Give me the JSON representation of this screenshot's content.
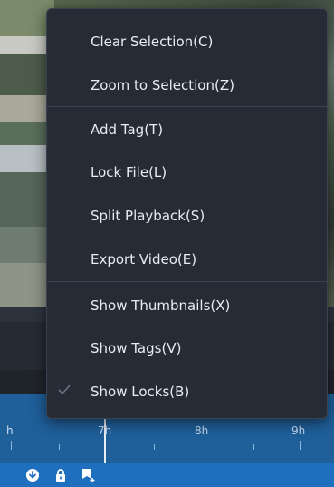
{
  "menu": {
    "items": [
      {
        "label": "Clear Selection(C)",
        "checked": false
      },
      {
        "label": "Zoom to Selection(Z)",
        "checked": false
      },
      {
        "label": "Add Tag(T)",
        "checked": false
      },
      {
        "label": "Lock File(L)",
        "checked": false
      },
      {
        "label": "Split Playback(S)",
        "checked": false
      },
      {
        "label": "Export Video(E)",
        "checked": false
      },
      {
        "label": "Show Thumbnails(X)",
        "checked": false
      },
      {
        "label": "Show Tags(V)",
        "checked": false
      },
      {
        "label": "Show Locks(B)",
        "checked": true
      }
    ]
  },
  "timeline": {
    "labels": [
      "h",
      "7h",
      "8h",
      "9h"
    ]
  },
  "bottombar": {
    "icons": [
      "download-icon",
      "lock-icon",
      "add-tag-icon"
    ]
  }
}
